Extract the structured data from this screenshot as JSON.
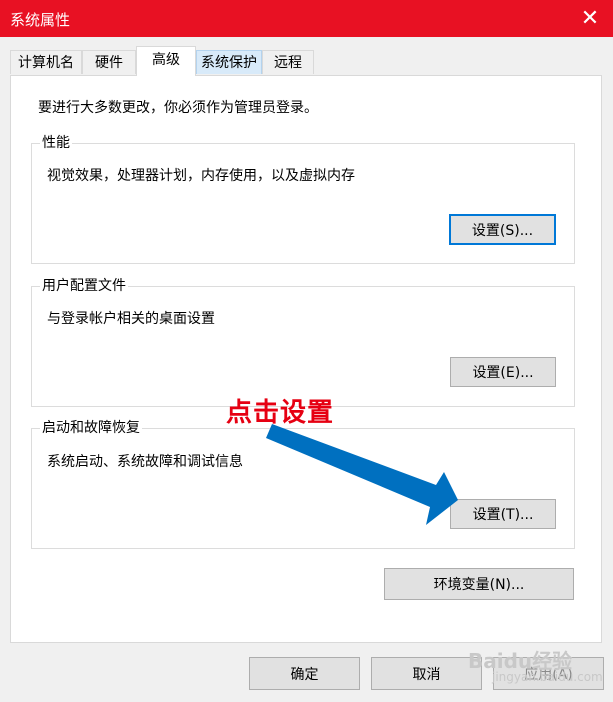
{
  "window": {
    "title": "系统属性",
    "close_glyph": "✕"
  },
  "tabs": [
    {
      "label": "计算机名"
    },
    {
      "label": "硬件"
    },
    {
      "label": "高级",
      "active": true
    },
    {
      "label": "系统保护"
    },
    {
      "label": "远程"
    }
  ],
  "advanced": {
    "info_text": "要进行大多数更改，你必须作为管理员登录。",
    "performance": {
      "title": "性能",
      "description": "视觉效果，处理器计划，内存使用，以及虚拟内存",
      "button": "设置(S)..."
    },
    "user_profiles": {
      "title": "用户配置文件",
      "description": "与登录帐户相关的桌面设置",
      "button": "设置(E)..."
    },
    "startup_recovery": {
      "title": "启动和故障恢复",
      "description": "系统启动、系统故障和调试信息",
      "button": "设置(T)..."
    },
    "env_button": "环境变量(N)..."
  },
  "footer": {
    "ok": "确定",
    "cancel": "取消",
    "apply": "应用(A)"
  },
  "annotation": {
    "text": "点击设置",
    "color": "#e60012",
    "arrow_color": "#0070c0"
  },
  "watermark": {
    "text": "Baidu经验",
    "sub": "jingyan.baidu.com"
  },
  "colors": {
    "titlebar": "#e81123",
    "focus": "#0078d7"
  }
}
